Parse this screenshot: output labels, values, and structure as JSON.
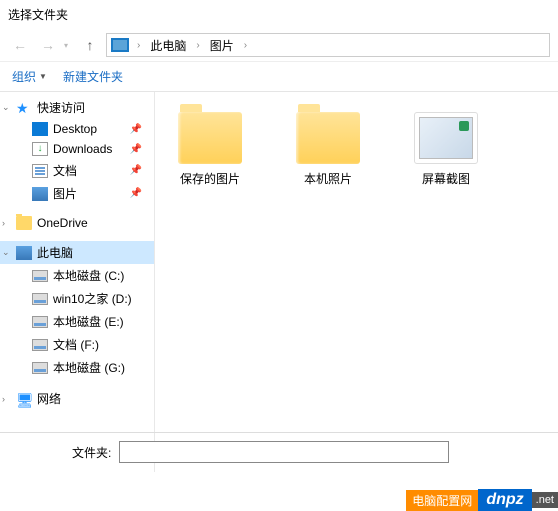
{
  "title": "选择文件夹",
  "breadcrumbs": [
    "此电脑",
    "图片"
  ],
  "toolbar": {
    "organize": "组织",
    "new_folder": "新建文件夹"
  },
  "sidebar": {
    "quick_access": "快速访问",
    "items": [
      {
        "label": "Desktop"
      },
      {
        "label": "Downloads"
      },
      {
        "label": "文档"
      },
      {
        "label": "图片"
      }
    ],
    "onedrive": "OneDrive",
    "this_pc": "此电脑",
    "drives": [
      {
        "label": "本地磁盘 (C:)"
      },
      {
        "label": "win10之家 (D:)"
      },
      {
        "label": "本地磁盘 (E:)"
      },
      {
        "label": "文档 (F:)"
      },
      {
        "label": "本地磁盘 (G:)"
      }
    ],
    "network": "网络"
  },
  "folders": [
    {
      "label": "保存的图片"
    },
    {
      "label": "本机照片"
    },
    {
      "label": "屏幕截图"
    }
  ],
  "bottom": {
    "label": "文件夹:",
    "value": ""
  },
  "watermark": {
    "cn": "电脑配置网",
    "domain": "dnpz",
    "tld": ".net"
  }
}
